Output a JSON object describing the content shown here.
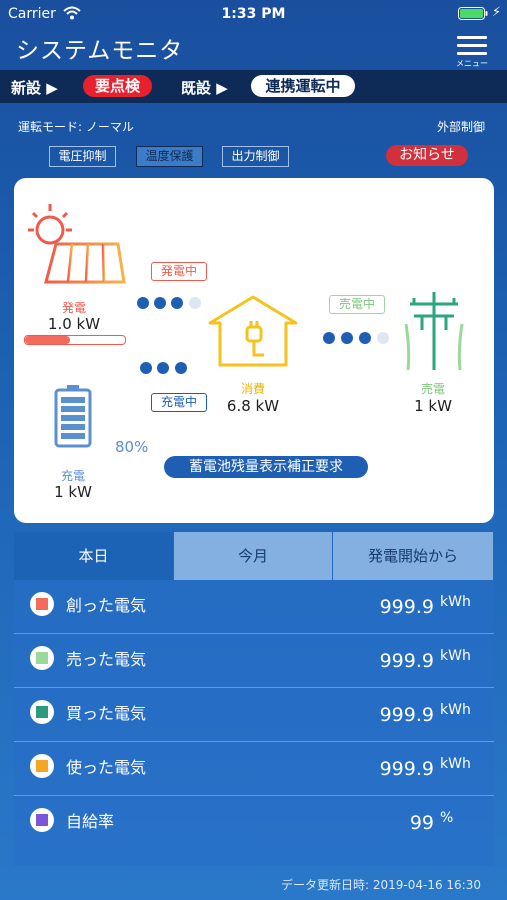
{
  "status_bar": {
    "carrier": "Carrier",
    "time": "1:33 PM"
  },
  "nav": {
    "title": "システムモニタ",
    "menu_label": "メニュー"
  },
  "status_row": {
    "new_label": "新設 ▶",
    "new_badge": "要点検",
    "existing_label": "既設 ▶",
    "existing_badge": "連携運転中"
  },
  "mode": {
    "text": "運転モード: ノーマル",
    "external": "外部制御",
    "tags": [
      "電圧抑制",
      "温度保護",
      "出力制御"
    ],
    "notice": "お知らせ"
  },
  "card": {
    "generation": {
      "label": "発電",
      "value": "1.0 kW",
      "badge": "発電中",
      "progress": 0.45
    },
    "consumption": {
      "label": "消費",
      "value": "6.8 kW"
    },
    "sell": {
      "label": "売電",
      "value": "1 kW",
      "badge": "売電中"
    },
    "battery": {
      "label": "充電",
      "value": "1 kW",
      "percent": "80%",
      "badge": "充電中"
    },
    "calibration": "蓄電池残量表示補正要求"
  },
  "tabs": [
    "本日",
    "今月",
    "発電開始から"
  ],
  "rows": [
    {
      "label": "創った電気",
      "value": "999.9",
      "unit": "kWh",
      "color": "#f26b5b"
    },
    {
      "label": "売った電気",
      "value": "999.9",
      "unit": "kWh",
      "color": "#9bd89b"
    },
    {
      "label": "買った電気",
      "value": "999.9",
      "unit": "kWh",
      "color": "#2a9c7c"
    },
    {
      "label": "使った電気",
      "value": "999.9",
      "unit": "kWh",
      "color": "#f5a623"
    },
    {
      "label": "自給率",
      "value": "99",
      "unit": "%",
      "color": "#7b57d6"
    }
  ],
  "footer": {
    "updated": "データ更新日時: 2019-04-16 16:30"
  }
}
